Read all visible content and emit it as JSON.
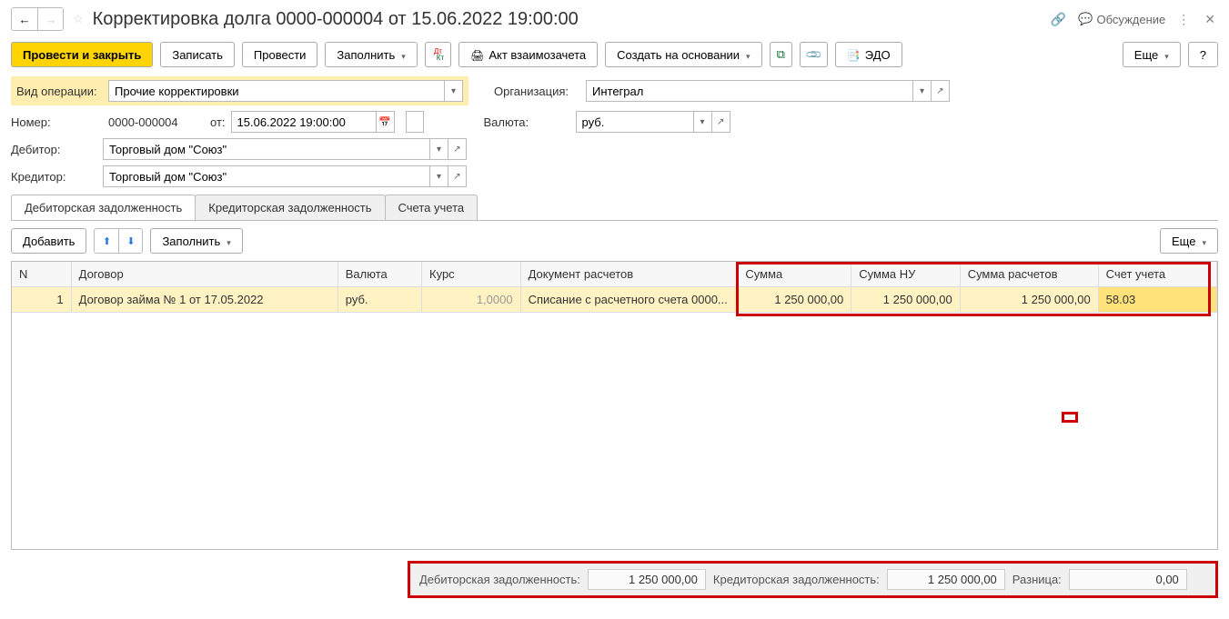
{
  "header": {
    "title": "Корректировка долга 0000-000004 от 15.06.2022 19:00:00",
    "discussion": "Обсуждение"
  },
  "toolbar": {
    "post_close": "Провести и закрыть",
    "write": "Записать",
    "post": "Провести",
    "fill": "Заполнить",
    "act": "Акт взаимозачета",
    "create_based": "Создать на основании",
    "edo": "ЭДО",
    "more": "Еще",
    "help": "?"
  },
  "fields": {
    "op_type_label": "Вид операции:",
    "op_type_value": "Прочие корректировки",
    "org_label": "Организация:",
    "org_value": "Интеграл",
    "number_label": "Номер:",
    "number_value": "0000-000004",
    "from_label": "от:",
    "date_value": "15.06.2022 19:00:00",
    "currency_label": "Валюта:",
    "currency_value": "руб.",
    "debtor_label": "Дебитор:",
    "debtor_value": "Торговый дом \"Союз\"",
    "creditor_label": "Кредитор:",
    "creditor_value": "Торговый дом \"Союз\""
  },
  "tabs": {
    "t1": "Дебиторская задолженность",
    "t2": "Кредиторская задолженность",
    "t3": "Счета учета"
  },
  "tab_toolbar": {
    "add": "Добавить",
    "fill": "Заполнить",
    "more": "Еще"
  },
  "grid": {
    "cols": {
      "n": "N",
      "contract": "Договор",
      "currency": "Валюта",
      "rate": "Курс",
      "doc": "Документ расчетов",
      "sum": "Сумма",
      "sum_nu": "Сумма НУ",
      "sum_calc": "Сумма расчетов",
      "account": "Счет учета"
    },
    "rows": [
      {
        "n": "1",
        "contract": "Договор займа № 1 от 17.05.2022",
        "currency": "руб.",
        "rate": "1,0000",
        "doc": "Списание с расчетного счета 0000...",
        "sum": "1 250 000,00",
        "sum_nu": "1 250 000,00",
        "sum_calc": "1 250 000,00",
        "account": "58.03"
      }
    ]
  },
  "totals": {
    "deb_label": "Дебиторская задолженность:",
    "deb_value": "1 250 000,00",
    "cred_label": "Кредиторская задолженность:",
    "cred_value": "1 250 000,00",
    "diff_label": "Разница:",
    "diff_value": "0,00"
  }
}
